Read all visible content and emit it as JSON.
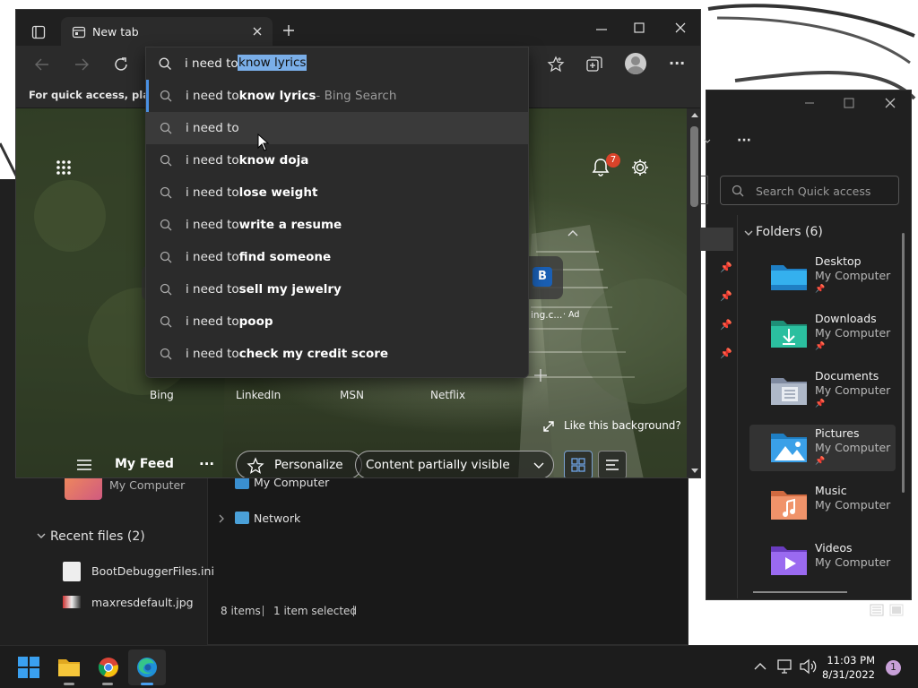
{
  "browser": {
    "tab_title": "New tab",
    "address_typed": "i need to ",
    "address_selected": "know lyrics",
    "favorites_bar_hint": "For quick access, place y",
    "suggestions": [
      {
        "prefix": "i need to ",
        "bold": "know lyrics",
        "suffix": " - Bing Search"
      },
      {
        "prefix": "i need to",
        "bold": "",
        "suffix": ""
      },
      {
        "prefix": "i need to ",
        "bold": "know doja",
        "suffix": ""
      },
      {
        "prefix": "i need to ",
        "bold": "lose weight",
        "suffix": ""
      },
      {
        "prefix": "i need to ",
        "bold": "write a resume",
        "suffix": ""
      },
      {
        "prefix": "i need to ",
        "bold": "find someone",
        "suffix": ""
      },
      {
        "prefix": "i need to ",
        "bold": "sell my jewelry",
        "suffix": ""
      },
      {
        "prefix": "i need to ",
        "bold": "poop",
        "suffix": ""
      },
      {
        "prefix": "i need to ",
        "bold": "check my credit score",
        "suffix": ""
      }
    ],
    "notification_count": "7",
    "quick_links": [
      "Bing",
      "LinkedIn",
      "MSN",
      "Netflix"
    ],
    "ad_tile_letter": "B",
    "ad_tile_label": "ing.c...",
    "ad_tag": "· Ad",
    "like_background": "Like this background?",
    "feed": {
      "my_feed": "My Feed",
      "more": "···",
      "personalize": "Personalize",
      "content_visibility": "Content partially visible"
    }
  },
  "explorer": {
    "my_computer": "My Computer",
    "recent_files_header": "Recent files (2)",
    "recent_files": [
      "BootDebuggerFiles.ini",
      "maxresdefault.jpg"
    ],
    "nav_my_computer": "My Computer",
    "nav_network": "Network",
    "status_items": "8 items",
    "status_selected": "1 item selected"
  },
  "quick_access": {
    "more": "···",
    "search_placeholder": "Search Quick access",
    "folders_header": "Folders (6)",
    "folders": [
      {
        "name": "Desktop",
        "location": "My Computer",
        "color": "#2fa7e6"
      },
      {
        "name": "Downloads",
        "location": "My Computer",
        "color": "#2bb59a"
      },
      {
        "name": "Documents",
        "location": "My Computer",
        "color": "#9aa6b8"
      },
      {
        "name": "Pictures",
        "location": "My Computer",
        "color": "#3aa0e8"
      },
      {
        "name": "Music",
        "location": "My Computer",
        "color": "#e8875a"
      },
      {
        "name": "Videos",
        "location": "My Computer",
        "color": "#8a5ae0"
      }
    ]
  },
  "taskbar": {
    "time": "11:03 PM",
    "date": "8/31/2022",
    "notification_badge": "1"
  }
}
